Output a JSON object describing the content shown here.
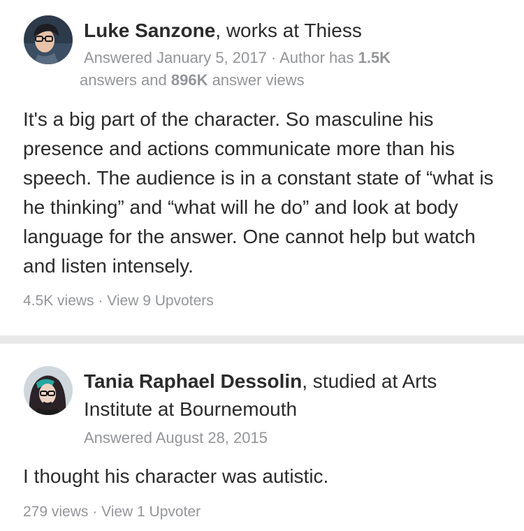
{
  "answers": [
    {
      "author": "Luke Sanzone",
      "credential": ", works at Thiess",
      "answered": "Answered January 5, 2017",
      "stats_sep": " · ",
      "author_has": "Author has ",
      "answers_count": "1.5K",
      "answers_word": " answers and ",
      "views_count": "896K",
      "views_word": " answer views",
      "text": "It's a big part of the character. So masculine his presence and actions communicate more than his speech. The audience is in a constant state of “what is he thinking” and “what will he do” and look at body language for the answer. One cannot help but watch and listen intensely.",
      "views": "4.5K views",
      "sep": " · ",
      "upvoters": "View 9 Upvoters"
    },
    {
      "author": "Tania Raphael Dessolin",
      "credential": ", studied at Arts",
      "credential_line2": "Institute at Bournemouth",
      "answered": "Answered August 28, 2015",
      "text": "I thought his character was autistic.",
      "views": "279 views",
      "sep": " · ",
      "upvoters": "View 1 Upvoter"
    }
  ],
  "colors": {
    "text": "#2b2b2b",
    "meta": "#939598",
    "divider": "#e9e9e9"
  }
}
